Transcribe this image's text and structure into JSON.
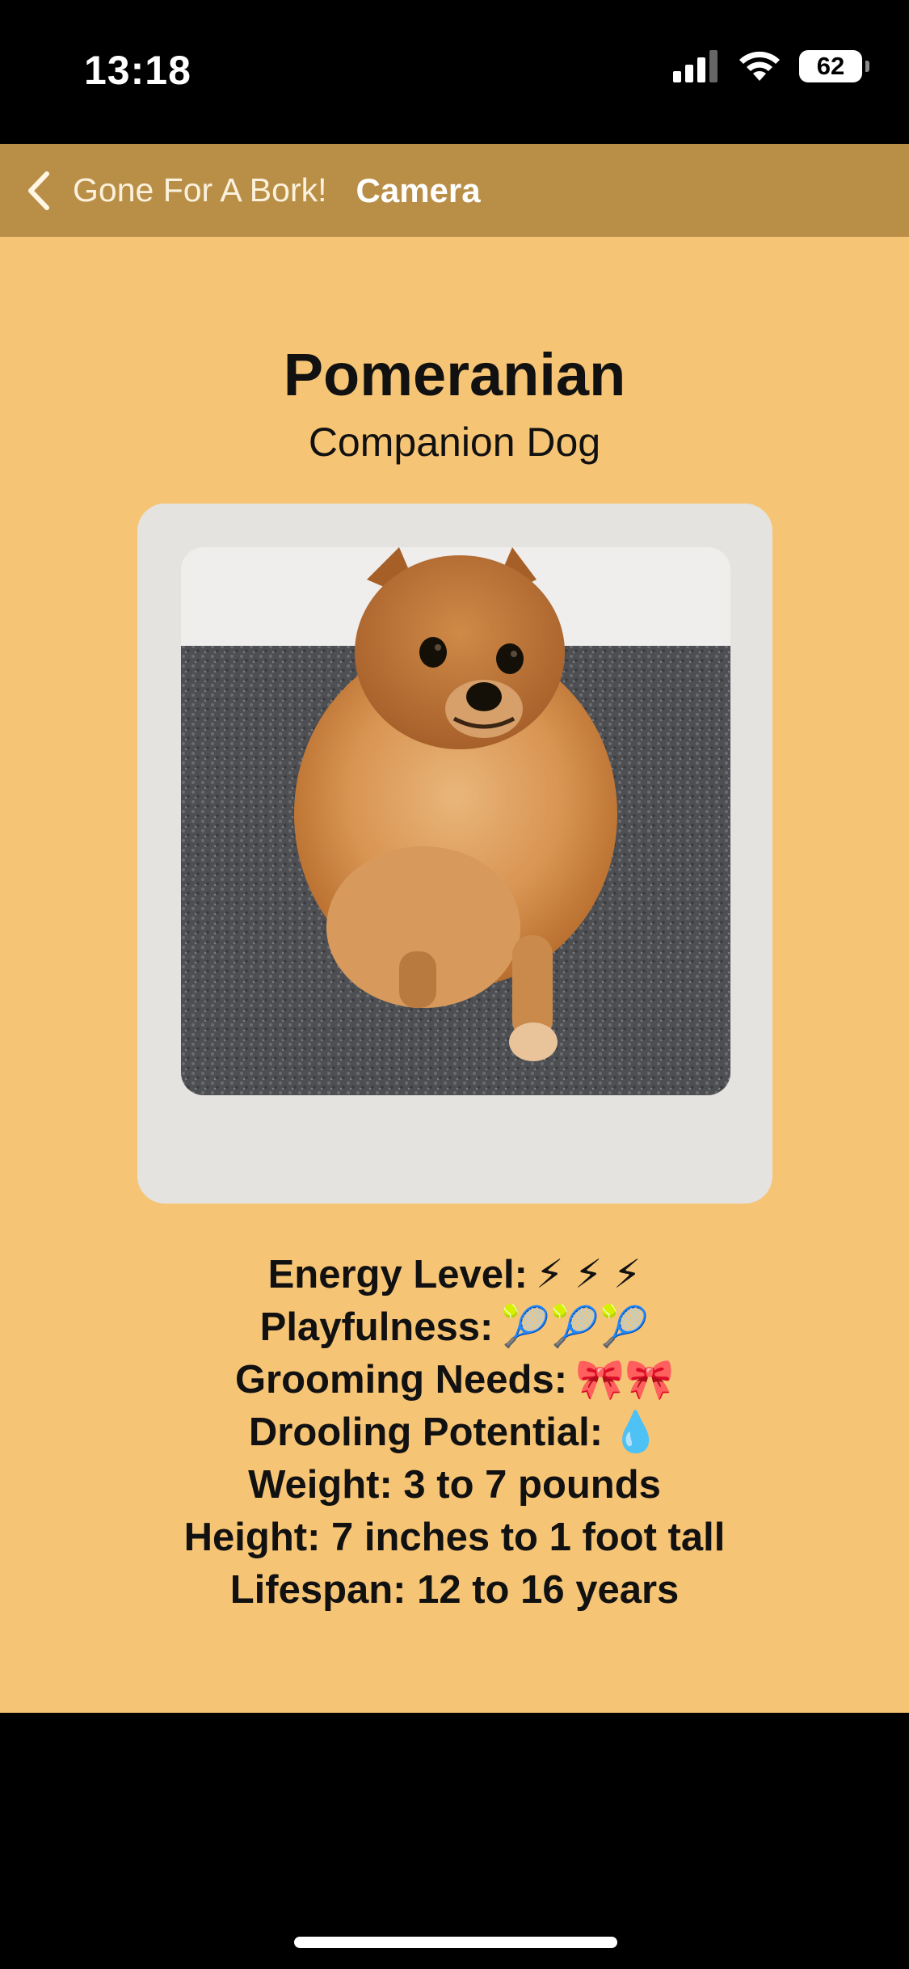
{
  "status_bar": {
    "time": "13:18",
    "battery": "62"
  },
  "nav": {
    "back_label": "Gone For A Bork!",
    "title": "Camera"
  },
  "breed": {
    "name": "Pomeranian",
    "group": "Companion Dog"
  },
  "traits": [
    {
      "text": "Energy Level:",
      "icons": "⚡ ⚡ ⚡"
    },
    {
      "text": "Playfulness:",
      "icons": "🎾🎾🎾"
    },
    {
      "text": "Grooming Needs:",
      "icons": "🎀🎀"
    },
    {
      "text": "Drooling Potential:",
      "icons": "💧"
    },
    {
      "text": "Weight: 3 to 7 pounds",
      "icons": ""
    },
    {
      "text": "Height: 7 inches to 1 foot tall",
      "icons": ""
    },
    {
      "text": "Lifespan: 12 to 16 years",
      "icons": ""
    }
  ],
  "colors": {
    "nav_bar": "#b98f48",
    "content_bg": "#f6c475",
    "card_bg": "#e5e3df"
  }
}
